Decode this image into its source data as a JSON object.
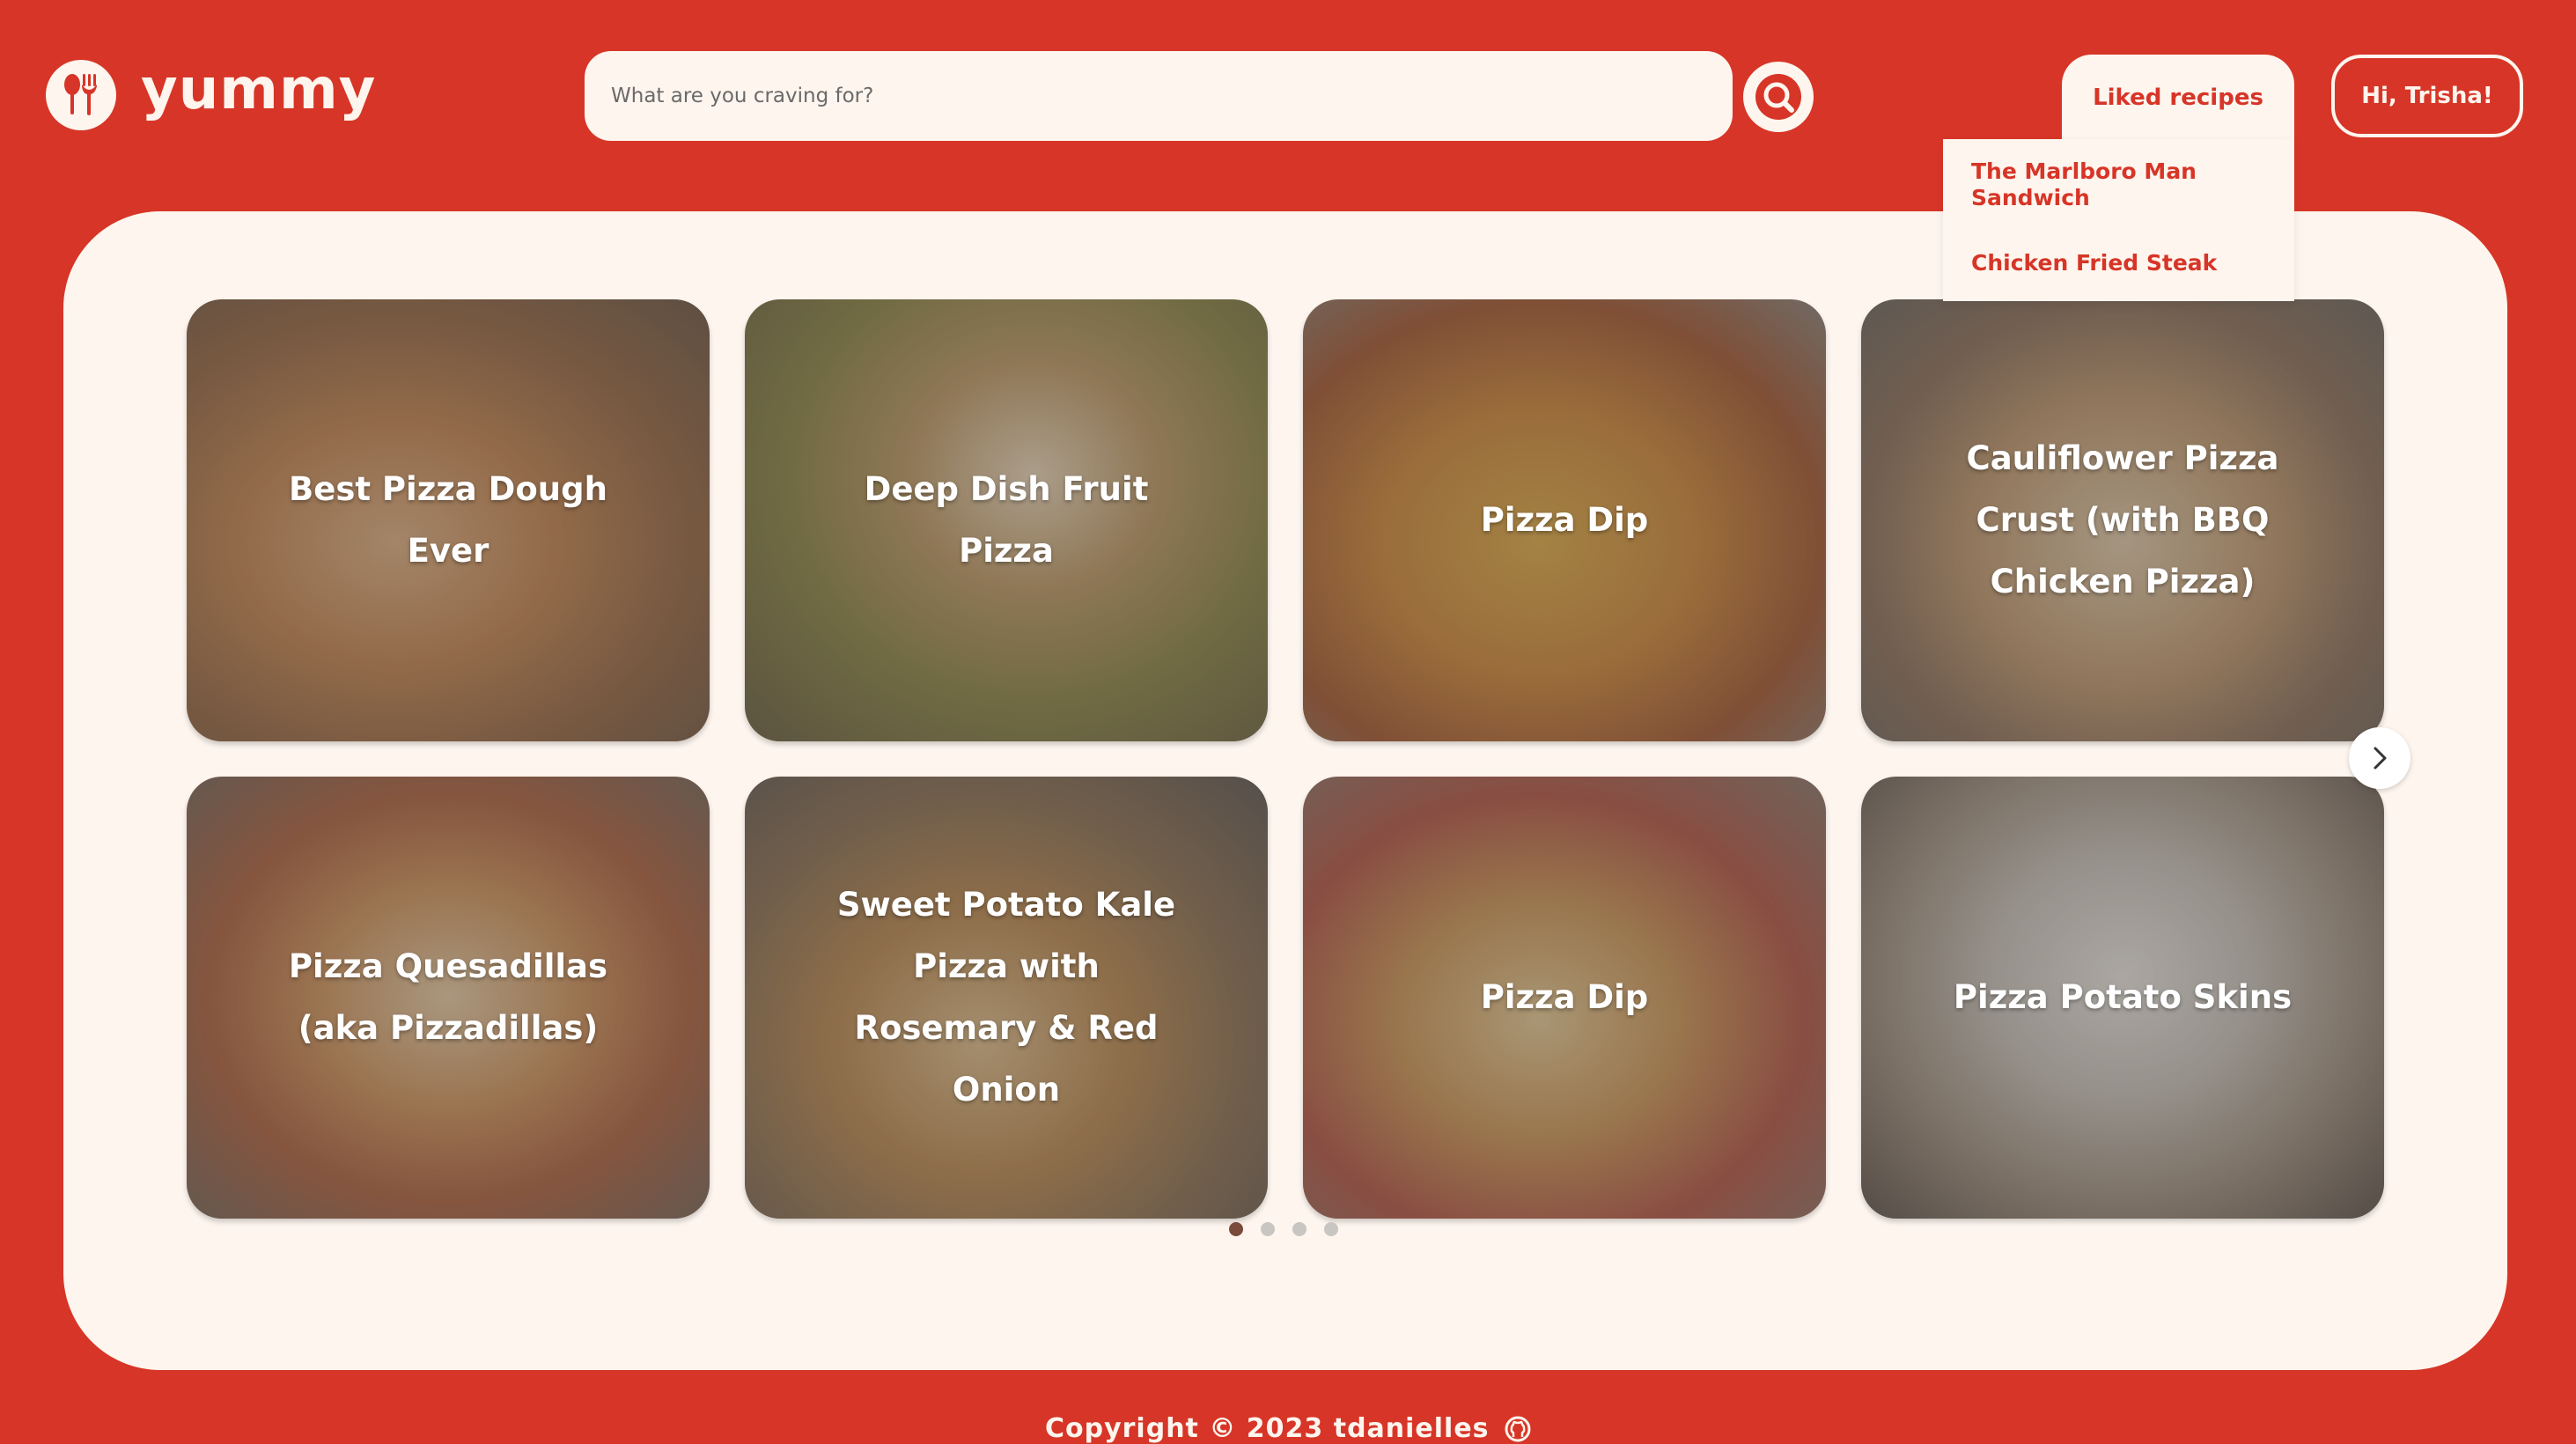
{
  "brand": {
    "name": "yummy"
  },
  "search": {
    "placeholder": "What are you craving for?",
    "value": ""
  },
  "header": {
    "liked_label": "Liked recipes",
    "user_label": "Hi, Trisha!"
  },
  "liked_dropdown": {
    "items": [
      "The Marlboro Man Sandwich",
      "Chicken Fried Steak"
    ]
  },
  "recipes": [
    {
      "title": "Best Pizza Dough Ever"
    },
    {
      "title": "Deep Dish Fruit Pizza"
    },
    {
      "title": "Pizza Dip"
    },
    {
      "title": "Cauliflower Pizza Crust (with BBQ Chicken Pizza)"
    },
    {
      "title": "Pizza Quesadillas (aka Pizzadillas)"
    },
    {
      "title": "Sweet Potato Kale Pizza with Rosemary & Red Onion"
    },
    {
      "title": "Pizza Dip"
    },
    {
      "title": "Pizza Potato Skins"
    }
  ],
  "carousel": {
    "page_count": 4,
    "active_page": 1
  },
  "footer": {
    "copyright": "Copyright © 2023 tdanielles"
  },
  "colors": {
    "brand_red": "#d73527",
    "cream": "#fdf5ee"
  }
}
